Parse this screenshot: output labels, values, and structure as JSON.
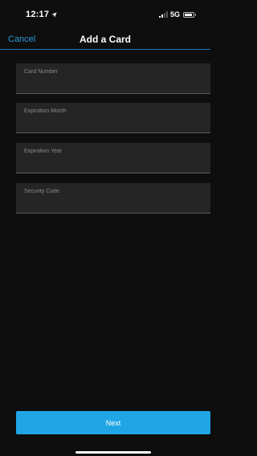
{
  "status_bar": {
    "time": "12:17",
    "network": "5G",
    "icons": [
      "location-arrow-icon",
      "signal-bars-icon",
      "battery-icon"
    ]
  },
  "nav": {
    "cancel_label": "Cancel",
    "title": "Add a Card"
  },
  "form": {
    "card_number": {
      "placeholder": "Card Number",
      "value": ""
    },
    "expiration_month": {
      "placeholder": "Expiration Month",
      "value": ""
    },
    "expiration_year": {
      "placeholder": "Expiration Year",
      "value": ""
    },
    "security_code": {
      "placeholder": "Security Code",
      "value": ""
    }
  },
  "actions": {
    "next_label": "Next"
  },
  "colors": {
    "background": "#0e0e0e",
    "field_background": "#252525",
    "accent": "#21a6e5",
    "link": "#2a9ad9",
    "nav_divider": "#1a7bb8"
  }
}
